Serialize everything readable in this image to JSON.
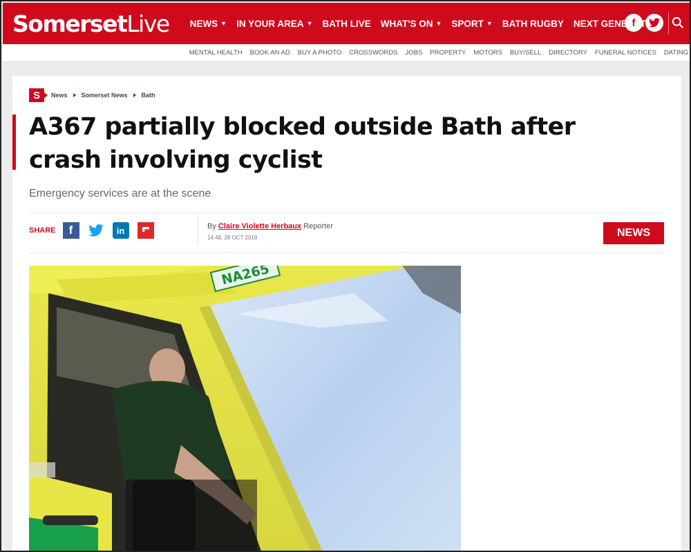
{
  "header": {
    "logo_main": "Somerset",
    "logo_live": "Live",
    "nav": [
      {
        "label": "NEWS",
        "dropdown": true
      },
      {
        "label": "IN YOUR AREA",
        "dropdown": true
      },
      {
        "label": "BATH LIVE",
        "dropdown": false
      },
      {
        "label": "WHAT'S ON",
        "dropdown": true
      },
      {
        "label": "SPORT",
        "dropdown": true
      },
      {
        "label": "BATH RUGBY",
        "dropdown": false
      },
      {
        "label": "NEXT GENERATION",
        "dropdown": false
      }
    ],
    "social": [
      {
        "icon": "facebook-icon",
        "glyph": "f"
      },
      {
        "icon": "twitter-icon",
        "glyph": ""
      }
    ],
    "search_icon": "search-icon",
    "brand_color": "#cf0a1d"
  },
  "subnav": [
    "MENTAL HEALTH",
    "BOOK AN AD",
    "BUY A PHOTO",
    "CROSSWORDS",
    "JOBS",
    "PROPERTY",
    "MOTORS",
    "BUY/SELL",
    "DIRECTORY",
    "FUNERAL NOTICES",
    "DATING"
  ],
  "article": {
    "brand_mark": "S",
    "breadcrumb": [
      "News",
      "Somerset News",
      "Bath"
    ],
    "headline": "A367 partially blocked outside Bath after crash involving cyclist",
    "standfirst": "Emergency services are at the scene",
    "share_label": "SHARE",
    "share_icons": [
      "facebook-icon",
      "twitter-icon",
      "linkedin-icon",
      "flipboard-icon"
    ],
    "byline_prefix": "By",
    "author": "Claire Violette Herbaux",
    "author_role": "Reporter",
    "timestamp": "14:48, 28 OCT 2018",
    "category_badge": "NEWS",
    "hero_plate": "NA265"
  }
}
